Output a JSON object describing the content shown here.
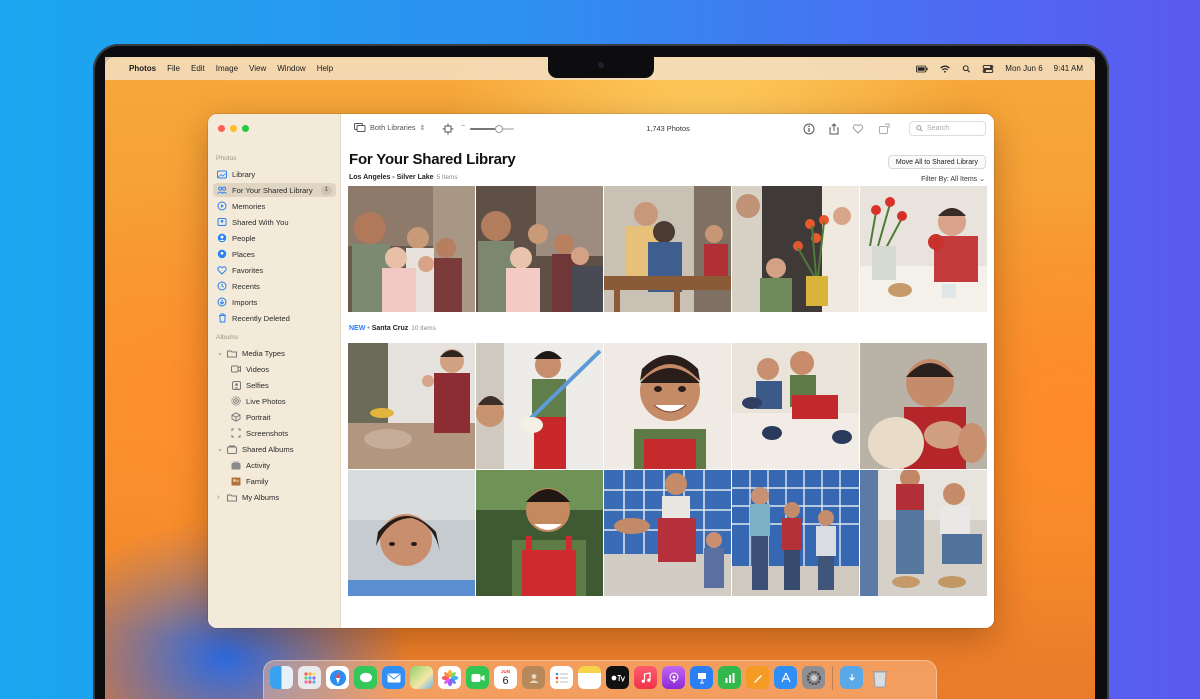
{
  "menubar": {
    "apple": "",
    "app": "Photos",
    "items": [
      "File",
      "Edit",
      "Image",
      "View",
      "Window",
      "Help"
    ],
    "date": "Mon Jun 6",
    "time": "9:41 AM"
  },
  "sidebar": {
    "photos_header": "Photos",
    "library": "Library",
    "shared_library": "For Your Shared Library",
    "shared_library_badge": "1",
    "memories": "Memories",
    "shared_with_you": "Shared With You",
    "people": "People",
    "places": "Places",
    "favorites": "Favorites",
    "recents": "Recents",
    "imports": "Imports",
    "recently_deleted": "Recently Deleted",
    "albums_header": "Albums",
    "media_types": "Media Types",
    "videos": "Videos",
    "selfies": "Selfies",
    "live_photos": "Live Photos",
    "portrait": "Portrait",
    "screenshots": "Screenshots",
    "shared_albums": "Shared Albums",
    "activity": "Activity",
    "family": "Family",
    "my_albums": "My Albums"
  },
  "toolbar": {
    "library_selector": "Both Libraries",
    "photo_count": "1,743 Photos",
    "search_placeholder": "Search",
    "zoom_fraction": 0.7
  },
  "main": {
    "title": "For Your Shared Library",
    "move_all_button": "Move All to Shared Library",
    "filter": "Filter By: All Items",
    "section1": {
      "location": "Los Angeles - Silver Lake",
      "count": "5 Items"
    },
    "section2": {
      "new_label": "NEW",
      "separator": "•",
      "location": "Santa Cruz",
      "count": "10 Items"
    }
  },
  "dock": {
    "calendar_month": "JUN",
    "calendar_day": "6"
  },
  "colors": {
    "accent": "#2a80f5",
    "sidebar_bg": "#f3ead9",
    "close": "#ff5f57",
    "minimize": "#febc2e",
    "zoom": "#28c840"
  }
}
